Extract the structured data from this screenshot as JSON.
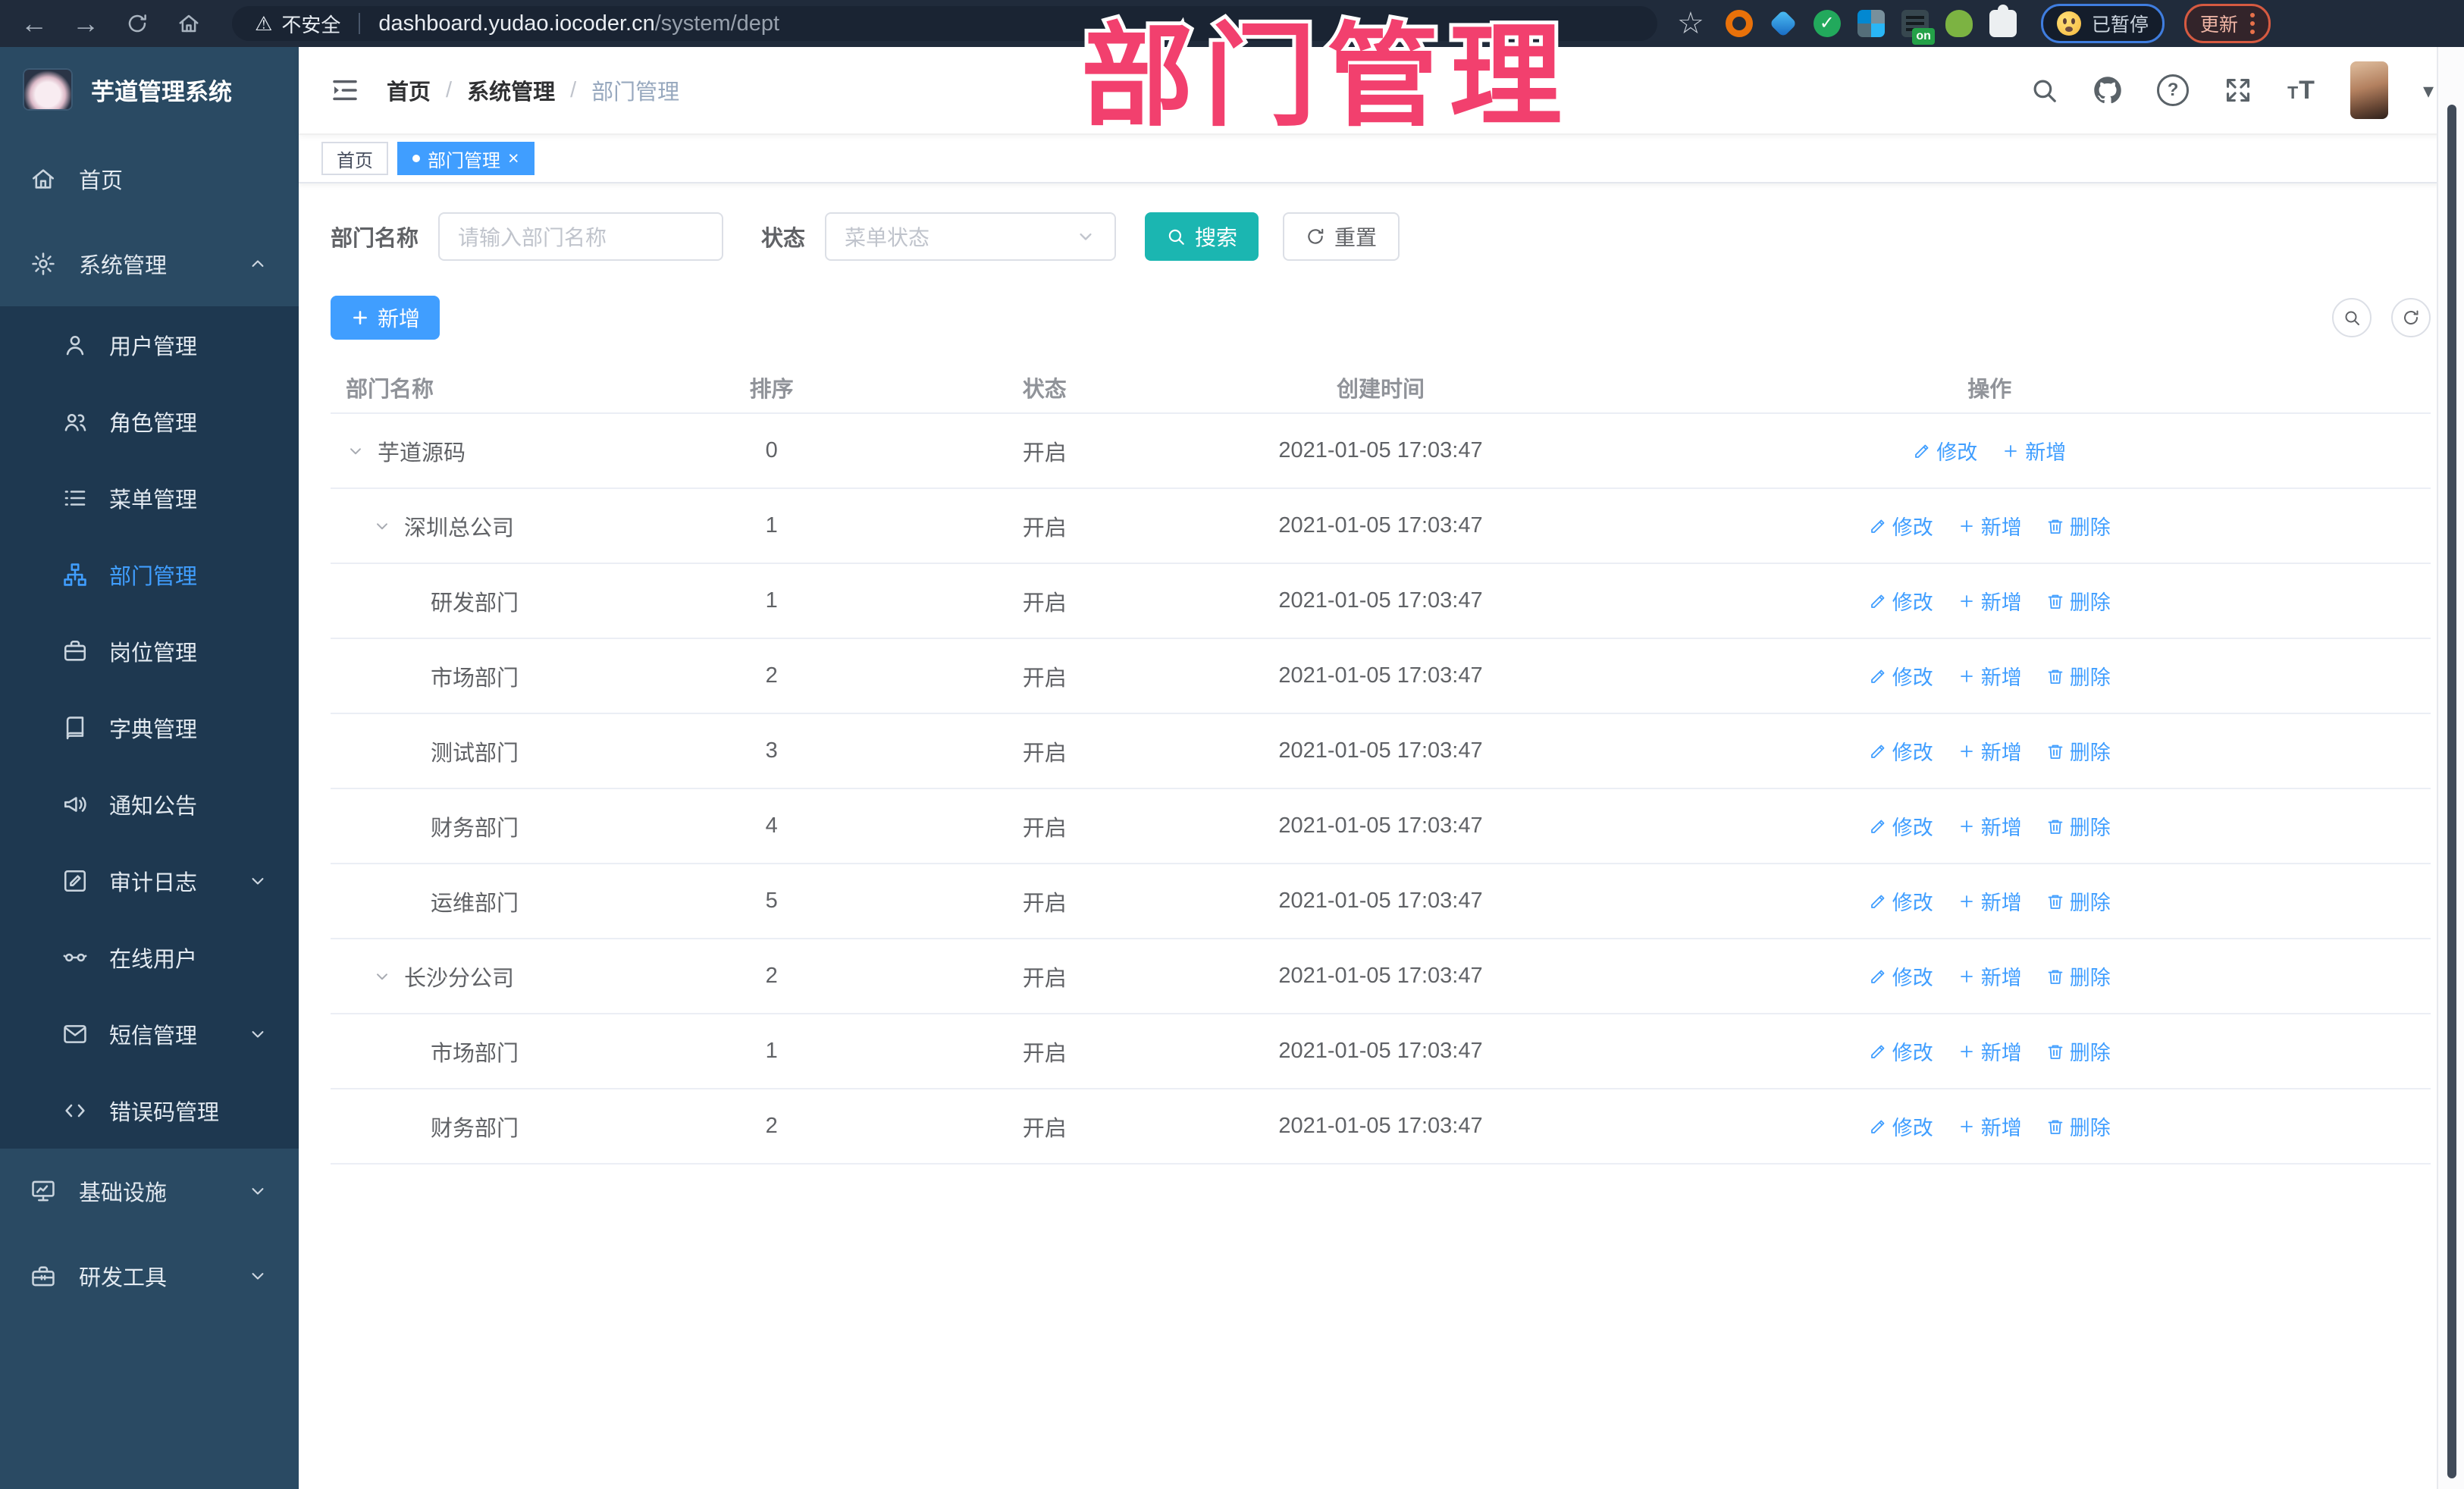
{
  "overlay_title": "部门管理",
  "browser": {
    "security_label": "不安全",
    "url_host": "dashboard.yudao.iocoder.cn",
    "url_path": "/system/dept",
    "paused_label": "已暂停",
    "update_label": "更新",
    "extensions": [
      {
        "name": "ext-orange"
      },
      {
        "name": "ext-blue"
      },
      {
        "name": "ext-green-v"
      },
      {
        "name": "ext-grid"
      },
      {
        "name": "ext-stack",
        "badge": "on"
      },
      {
        "name": "ext-bot"
      },
      {
        "name": "ext-puzzle"
      }
    ]
  },
  "sidebar": {
    "logo_title": "芋道管理系统",
    "items": [
      {
        "id": "home",
        "label": "首页",
        "icon": "home"
      },
      {
        "id": "system",
        "label": "系统管理",
        "icon": "gear",
        "expanded": true,
        "children": [
          {
            "id": "user",
            "label": "用户管理",
            "icon": "user"
          },
          {
            "id": "role",
            "label": "角色管理",
            "icon": "users"
          },
          {
            "id": "menu",
            "label": "菜单管理",
            "icon": "list"
          },
          {
            "id": "dept",
            "label": "部门管理",
            "icon": "tree",
            "active": true
          },
          {
            "id": "post",
            "label": "岗位管理",
            "icon": "badge"
          },
          {
            "id": "dict",
            "label": "字典管理",
            "icon": "book"
          },
          {
            "id": "notice",
            "label": "通知公告",
            "icon": "megaphone"
          },
          {
            "id": "audit",
            "label": "审计日志",
            "icon": "log",
            "arrow": "down"
          },
          {
            "id": "online",
            "label": "在线用户",
            "icon": "online"
          },
          {
            "id": "sms",
            "label": "短信管理",
            "icon": "message",
            "arrow": "down"
          },
          {
            "id": "errcode",
            "label": "错误码管理",
            "icon": "code"
          }
        ]
      },
      {
        "id": "infra",
        "label": "基础设施",
        "icon": "monitor",
        "arrow": "down"
      },
      {
        "id": "devtool",
        "label": "研发工具",
        "icon": "toolbox",
        "arrow": "down"
      }
    ]
  },
  "header": {
    "breadcrumb": [
      "首页",
      "系统管理",
      "部门管理"
    ],
    "tabs": [
      {
        "label": "首页",
        "active": false,
        "closable": false
      },
      {
        "label": "部门管理",
        "active": true,
        "closable": true
      }
    ]
  },
  "filters": {
    "name_label": "部门名称",
    "name_placeholder": "请输入部门名称",
    "status_label": "状态",
    "status_placeholder": "菜单状态",
    "search_label": "搜索",
    "reset_label": "重置"
  },
  "toolbar": {
    "add_label": "新增"
  },
  "table": {
    "columns": [
      "部门名称",
      "排序",
      "状态",
      "创建时间",
      "操作"
    ],
    "action_labels": {
      "edit": "修改",
      "add": "新增",
      "delete": "删除"
    },
    "rows": [
      {
        "name": "芋道源码",
        "level": 0,
        "expandable": true,
        "sort": "0",
        "status": "开启",
        "created": "2021-01-05 17:03:47",
        "actions": [
          "edit",
          "add"
        ]
      },
      {
        "name": "深圳总公司",
        "level": 1,
        "expandable": true,
        "sort": "1",
        "status": "开启",
        "created": "2021-01-05 17:03:47",
        "actions": [
          "edit",
          "add",
          "delete"
        ]
      },
      {
        "name": "研发部门",
        "level": 2,
        "expandable": false,
        "sort": "1",
        "status": "开启",
        "created": "2021-01-05 17:03:47",
        "actions": [
          "edit",
          "add",
          "delete"
        ]
      },
      {
        "name": "市场部门",
        "level": 2,
        "expandable": false,
        "sort": "2",
        "status": "开启",
        "created": "2021-01-05 17:03:47",
        "actions": [
          "edit",
          "add",
          "delete"
        ]
      },
      {
        "name": "测试部门",
        "level": 2,
        "expandable": false,
        "sort": "3",
        "status": "开启",
        "created": "2021-01-05 17:03:47",
        "actions": [
          "edit",
          "add",
          "delete"
        ]
      },
      {
        "name": "财务部门",
        "level": 2,
        "expandable": false,
        "sort": "4",
        "status": "开启",
        "created": "2021-01-05 17:03:47",
        "actions": [
          "edit",
          "add",
          "delete"
        ]
      },
      {
        "name": "运维部门",
        "level": 2,
        "expandable": false,
        "sort": "5",
        "status": "开启",
        "created": "2021-01-05 17:03:47",
        "actions": [
          "edit",
          "add",
          "delete"
        ]
      },
      {
        "name": "长沙分公司",
        "level": 1,
        "expandable": true,
        "sort": "2",
        "status": "开启",
        "created": "2021-01-05 17:03:47",
        "actions": [
          "edit",
          "add",
          "delete"
        ]
      },
      {
        "name": "市场部门",
        "level": 2,
        "expandable": false,
        "sort": "1",
        "status": "开启",
        "created": "2021-01-05 17:03:47",
        "actions": [
          "edit",
          "add",
          "delete"
        ]
      },
      {
        "name": "财务部门",
        "level": 2,
        "expandable": false,
        "sort": "2",
        "status": "开启",
        "created": "2021-01-05 17:03:47",
        "actions": [
          "edit",
          "add",
          "delete"
        ]
      }
    ]
  },
  "colors": {
    "accent_blue": "#409EFF",
    "accent_teal": "#1BB6B1",
    "overlay_pink": "#F2406E",
    "sidebar_bg": "#2A4A63",
    "submenu_bg": "#1E3850",
    "browser_bar_bg": "#202B3B"
  }
}
